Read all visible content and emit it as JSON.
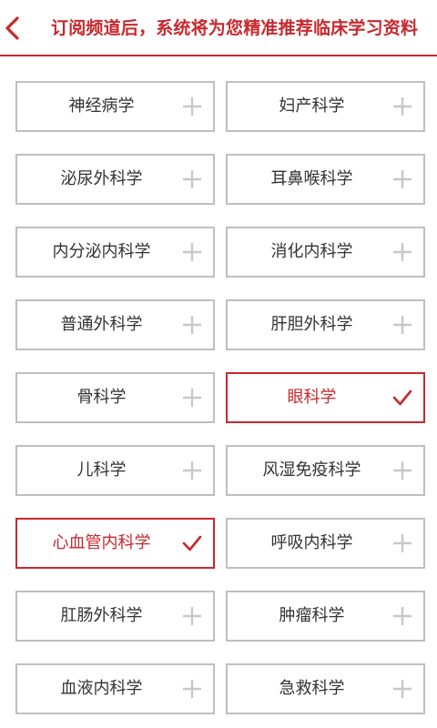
{
  "header": {
    "title": "订阅频道后，系统将为您精准推荐临床学习资料",
    "accent_color": "#c8282d"
  },
  "channels": [
    {
      "label": "神经病学",
      "selected": false
    },
    {
      "label": "妇产科学",
      "selected": false
    },
    {
      "label": "泌尿外科学",
      "selected": false
    },
    {
      "label": "耳鼻喉科学",
      "selected": false
    },
    {
      "label": "内分泌内科学",
      "selected": false
    },
    {
      "label": "消化内科学",
      "selected": false
    },
    {
      "label": "普通外科学",
      "selected": false
    },
    {
      "label": "肝胆外科学",
      "selected": false
    },
    {
      "label": "骨科学",
      "selected": false
    },
    {
      "label": "眼科学",
      "selected": true
    },
    {
      "label": "儿科学",
      "selected": false
    },
    {
      "label": "风湿免疫科学",
      "selected": false
    },
    {
      "label": "心血管内科学",
      "selected": true
    },
    {
      "label": "呼吸内科学",
      "selected": false
    },
    {
      "label": "肛肠外科学",
      "selected": false
    },
    {
      "label": "肿瘤科学",
      "selected": false
    },
    {
      "label": "血液内科学",
      "selected": false
    },
    {
      "label": "急救科学",
      "selected": false
    }
  ]
}
